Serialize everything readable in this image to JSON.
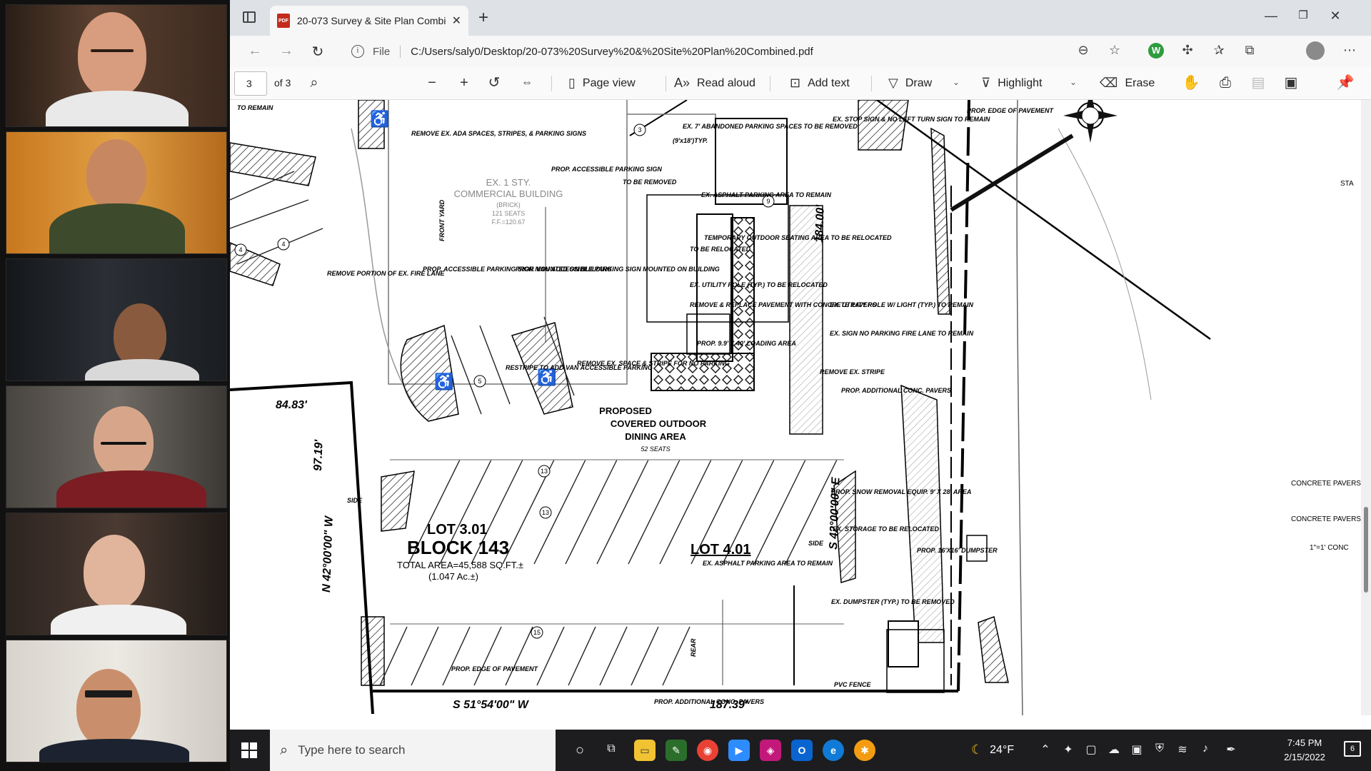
{
  "browser": {
    "tab": {
      "title": "20-073 Survey & Site Plan Combined.pdf",
      "file_badge": "PDF"
    },
    "new_tab_label": "+",
    "address": {
      "scheme_label": "File",
      "url": "C:/Users/saly0/Desktop/20-073%20Survey%20&%20Site%20Plan%20Combined.pdf"
    }
  },
  "pdf_toolbar": {
    "page_number": "3",
    "page_total": "of 3",
    "page_view": "Page view",
    "read_aloud": "Read aloud",
    "add_text": "Add text",
    "draw": "Draw",
    "highlight": "Highlight",
    "erase": "Erase"
  },
  "plan": {
    "lot_301": "LOT 3.01",
    "block": "BLOCK 143",
    "total_area": "TOTAL AREA=45,588 SQ.FT.±",
    "acreage": "(1.047 Ac.±)",
    "lot_401": "LOT 4.01",
    "building_1": "EX. 1 STY.",
    "building_2": "COMMERCIAL BUILDING",
    "building_3": "(BRICK)",
    "building_4": "121 SEATS",
    "building_5": "F.F.=120.67",
    "dining_1": "PROPOSED",
    "dining_2": "COVERED OUTDOOR",
    "dining_3": "DINING AREA",
    "dining_4": "52 SEATS",
    "bearing_north": "N 42°00'00\" W",
    "bearing_south": "S 51°54'00\" W",
    "bearing_east": "S 42°00'00\" E",
    "dist_184": "184.00'",
    "dist_187": "187.39'",
    "dist_9719": "97.19'",
    "dist_8483": "84.83'",
    "labels": [
      "TO REMAIN",
      "REMOVE EX. ADA SPACES, STRIPES, & PARKING SIGNS",
      "PROP. ACCESSIBLE PARKING SIGN",
      "PROP. ACCESSIBLE PARKING SIGN MOUNTED ON BUILDING",
      "PROP. VAN ACCESSIBLE PARKING SIGN MOUNTED ON BUILDING",
      "REMOVE PORTION OF EX. FIRE LANE",
      "RESTRIPE TO ADD VAN ACCESSIBLE PARKING",
      "REMOVE EX. SPACE & STRIPE FOR NO PARKING",
      "TO BE REMOVED",
      "TO BE RELOCATED",
      "REMOVE & REPLACE PAVEMENT WITH CONCRETE PAVERS",
      "PROP. 9.9' X 40' LOADING AREA",
      "REMOVE EX. STRIPE",
      "PROP. ADDITIONAL CONC. PAVERS",
      "PROP. SNOW REMOVAL EQUIP. 9' X 28' AREA",
      "PROP. 16'X16' DUMPSTER",
      "PROP. EDGE OF PAVEMENT",
      "PROP. EDGE OF PAVEMENT",
      "PROP. ADDITIONAL CONC. PAVERS",
      "FRONT YARD",
      "SIDE",
      "SIDE",
      "REAR",
      "(9'x18')TYP.",
      "EX. STORAGE TO BE RELOCATED",
      "EX. DUMPSTER (TYP.) TO BE REMOVED",
      "EX. UTILITY POLE W/ LIGHT (TYP.) TO REMAIN",
      "EX. STOP SIGN & NO LEFT TURN SIGN TO REMAIN",
      "EX. 7' ABANDONED PARKING SPACES TO BE REMOVED",
      "EX. ASPHALT PARKING AREA TO REMAIN",
      "TEMPORARY OUTDOOR SEATING AREA TO BE RELOCATED",
      "EX. UTILITY POLE (TYP.) TO BE RELOCATED",
      "EX. SIGN NO PARKING FIRE LANE TO REMAIN",
      "EX. ASPHALT PARKING AREA TO REMAIN",
      "PVC FENCE",
      "CONCRETE PAVERS WITH FINISHED REQUIRED FOR",
      "CONCRETE PAVERS COLOR TO BE",
      "1\"=1' CONC",
      "STA"
    ]
  },
  "taskbar": {
    "search_placeholder": "Type here to search",
    "weather": "24°F",
    "time": "7:45 PM",
    "date": "2/15/2022",
    "notifications": "6"
  },
  "participants": [
    {
      "shirt": "#eaeaea",
      "bg": "#3b2a20",
      "skin": "#d79a7c"
    },
    {
      "shirt": "#3a4a2a",
      "bg": "#d28a2c",
      "skin": "#c98a66"
    },
    {
      "shirt": "#dcdcdc",
      "bg": "#1f2226",
      "skin": "#8a5a3e"
    },
    {
      "shirt": "#7b1d22",
      "bg": "#5b5651",
      "skin": "#d7a68a"
    },
    {
      "shirt": "#f1f1f1",
      "bg": "#3a2f2a",
      "skin": "#e0b59b"
    },
    {
      "shirt": "#1c2230",
      "bg": "#d8d4cc",
      "skin": "#c98f6c"
    }
  ]
}
